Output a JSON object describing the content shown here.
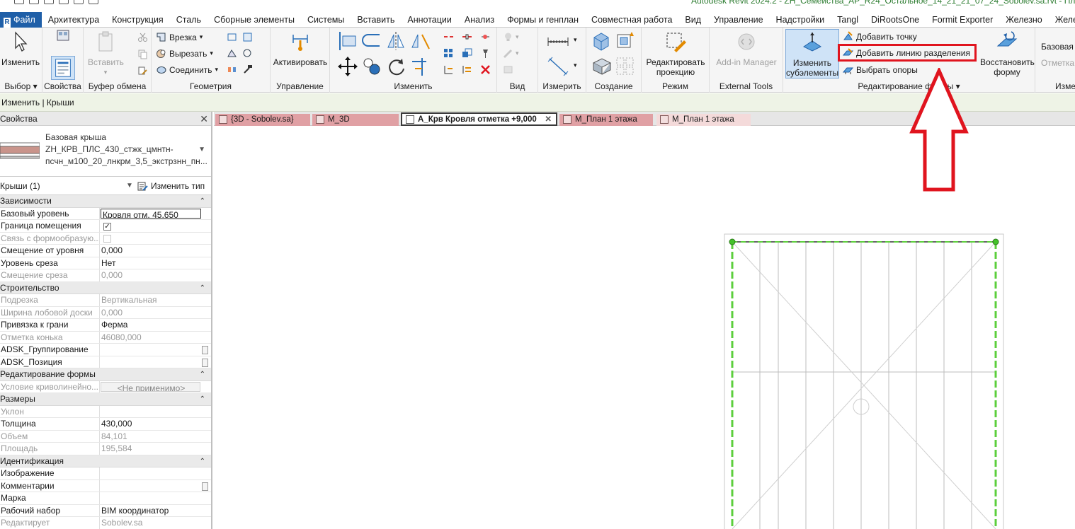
{
  "title_bar": {
    "document_title": "Autodesk Revit 2024.2 - ZH_Семейства_АР_R24_Остальное_14_21_21_07_24_Sobolev.sa.rvt - План эта..."
  },
  "menu_tabs": [
    {
      "label": "Файл"
    },
    {
      "label": "Архитектура"
    },
    {
      "label": "Конструкция"
    },
    {
      "label": "Сталь"
    },
    {
      "label": "Сборные элементы"
    },
    {
      "label": "Системы"
    },
    {
      "label": "Вставить"
    },
    {
      "label": "Аннотации"
    },
    {
      "label": "Анализ"
    },
    {
      "label": "Формы и генплан"
    },
    {
      "label": "Совместная работа"
    },
    {
      "label": "Вид"
    },
    {
      "label": "Управление"
    },
    {
      "label": "Надстройки"
    },
    {
      "label": "Tangl"
    },
    {
      "label": "DiRootsOne"
    },
    {
      "label": "Formit Exporter"
    },
    {
      "label": "Железно"
    },
    {
      "label": "Железно-разрабо"
    }
  ],
  "ribbon": {
    "select": {
      "button": "Изменить",
      "panel": "Выбор"
    },
    "properties": {
      "panel": "Свойства"
    },
    "clipboard": {
      "paste": "Вставить",
      "panel": "Буфер обмена"
    },
    "geometry": {
      "cut_in": "Врезка",
      "cut": "Вырезать",
      "join": "Соединить",
      "panel": "Геометрия"
    },
    "manage": {
      "activate": "Активировать",
      "panel": "Управление"
    },
    "modify": {
      "panel": "Изменить"
    },
    "view": {
      "panel": "Вид"
    },
    "measure": {
      "panel": "Измерить"
    },
    "create": {
      "panel": "Создание"
    },
    "mode": {
      "edit_projection_1": "Редактировать",
      "edit_projection_2": "проекцию",
      "panel": "Режим"
    },
    "external": {
      "addin_manager": "Add-in Manager",
      "panel": "External Tools"
    },
    "shape_edit": {
      "modify_sub_1": "Изменить",
      "modify_sub_2": "субэлементы",
      "add_point": "Добавить точку",
      "add_split_line": "Добавить линию разделения",
      "pick_supports": "Выбрать опоры",
      "reset_shape_1": "Восстановить",
      "reset_shape_2": "форму",
      "panel": "Редактирование формы"
    },
    "right_cut": {
      "base": "Базовая с",
      "offset": "Отметка",
      "panel": "Изме"
    }
  },
  "context_bar": {
    "text": "Изменить | Крыши"
  },
  "properties": {
    "header": "Свойства",
    "type_name_1": "Базовая крыша",
    "type_name_2": "ZH_КРВ_ПЛС_430_стжк_цмнтн-",
    "type_name_3": "псчн_м100_20_лнкрм_3,5_экстрзнн_пн...",
    "filter": "Крыши (1)",
    "edit_type": "Изменить тип",
    "groups": [
      {
        "name": "Зависимости",
        "rows": [
          {
            "k": "Базовый уровень",
            "v": "Кровля отм. 45.650",
            "state": "edit"
          },
          {
            "k": "Граница помещения",
            "v": "",
            "state": "checked"
          },
          {
            "k": "Связь с формообразую...",
            "v": "",
            "state": "unchecked-ro"
          },
          {
            "k": "Смещение от уровня",
            "v": "0,000",
            "state": "normal"
          },
          {
            "k": "Уровень среза",
            "v": "Нет",
            "state": "normal"
          },
          {
            "k": "Смещение среза",
            "v": "0,000",
            "state": "ro"
          }
        ]
      },
      {
        "name": "Строительство",
        "rows": [
          {
            "k": "Подрезка",
            "v": "Вертикальная",
            "state": "ro"
          },
          {
            "k": "Ширина лобовой доски",
            "v": "0,000",
            "state": "ro"
          },
          {
            "k": "Привязка к грани",
            "v": "Ферма",
            "state": "normal"
          },
          {
            "k": "Отметка конька",
            "v": "46080,000",
            "state": "ro"
          },
          {
            "k": "ADSK_Группирование",
            "v": "",
            "state": "btn"
          },
          {
            "k": "ADSK_Позиция",
            "v": "",
            "state": "btn"
          }
        ]
      },
      {
        "name": "Редактирование формы",
        "rows": [
          {
            "k": "Условие криволинейно...",
            "v": "<Не применимо>",
            "state": "na"
          }
        ]
      },
      {
        "name": "Размеры",
        "rows": [
          {
            "k": "Уклон",
            "v": "",
            "state": "ro"
          },
          {
            "k": "Толщина",
            "v": "430,000",
            "state": "normal"
          },
          {
            "k": "Объем",
            "v": "84,101",
            "state": "ro"
          },
          {
            "k": "Площадь",
            "v": "195,584",
            "state": "ro"
          }
        ]
      },
      {
        "name": "Идентификация",
        "rows": [
          {
            "k": "Изображение",
            "v": "",
            "state": "normal"
          },
          {
            "k": "Комментарии",
            "v": "",
            "state": "btn"
          },
          {
            "k": "Марка",
            "v": "",
            "state": "normal"
          },
          {
            "k": "Рабочий набор",
            "v": "BIM координатор",
            "state": "normal"
          },
          {
            "k": "Редактирует",
            "v": "Sobolev.sa",
            "state": "ro"
          }
        ]
      }
    ]
  },
  "view_tabs": [
    {
      "label": "{3D - Sobolev.sa}",
      "active": false
    },
    {
      "label": "М_3D",
      "active": false
    },
    {
      "label": "А_Крв Кровля отметка +9,000",
      "active": true
    },
    {
      "label": "М_План 1 этажа",
      "active": false
    },
    {
      "label": "М_План 1 этажа",
      "active": false
    }
  ],
  "colors": {
    "accent_red": "#e0141e",
    "file_tab": "#1f5fa8",
    "context_bar": "#eef3e6",
    "sketch_green": "#5ccf3c"
  }
}
